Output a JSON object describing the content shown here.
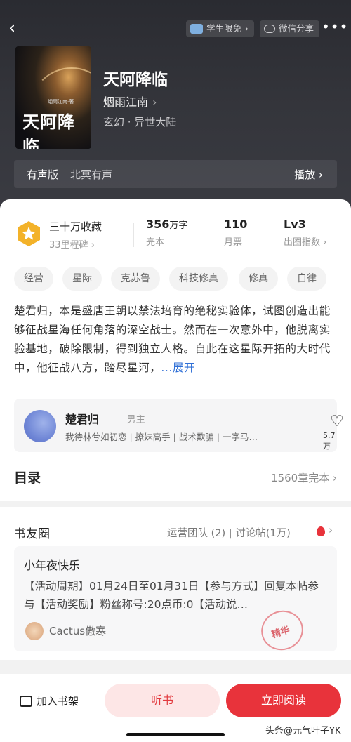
{
  "header": {
    "student_label": "学生限免",
    "wechat_label": "微信分享",
    "more_label": "•••"
  },
  "book": {
    "title": "天阿降临",
    "author": "烟雨江南",
    "genre": "玄幻 · 异世大陆",
    "cover_title": "天阿降临",
    "cover_author": "烟雨江南·著"
  },
  "audio": {
    "label": "有声版",
    "value": "北冥有声",
    "play_label": "播放"
  },
  "stats": {
    "favorites": "三十万收藏",
    "milestone": "33里程碑",
    "words_num": "356",
    "words_unit": "万字",
    "words_sub": "完本",
    "tickets": "110",
    "tickets_sub": "月票",
    "level": "Lv3",
    "level_sub": "出圈指数"
  },
  "tags": [
    "经营",
    "星际",
    "克苏鲁",
    "科技修真",
    "修真",
    "自律"
  ],
  "synopsis": {
    "text": "楚君归，本是盛唐王朝以禁法培育的绝秘实验体，试图创造出能够征战星海任何角落的深空战士。然而在一次意外中，他脱离实验基地，破除限制，得到独立人格。自此在这星际开拓的大时代中，他征战八方，踏尽星河，",
    "expand": "...展开"
  },
  "character": {
    "name": "楚君归",
    "role": "男主",
    "desc": "我待林兮如初恋 | 撩妹高手 | 战术欺骗 | 一字马…",
    "likes": "5.7万"
  },
  "toc": {
    "title": "目录",
    "status": "1560章完本"
  },
  "circle": {
    "title": "书友圈",
    "links": "运营团队 (2) | 讨论帖(1万)",
    "post_title": "小年夜快乐",
    "post_body": "【活动周期】01月24日至01月31日【参与方式】回复本帖参与【活动奖励】粉丝称号:20点币:0【活动说…",
    "post_user": "Cactus傲寒",
    "stamp": "精华"
  },
  "bottom": {
    "shelf_label": "加入书架",
    "listen_label": "听书",
    "read_label": "立即阅读"
  },
  "watermark": "头条@元气叶子YK"
}
